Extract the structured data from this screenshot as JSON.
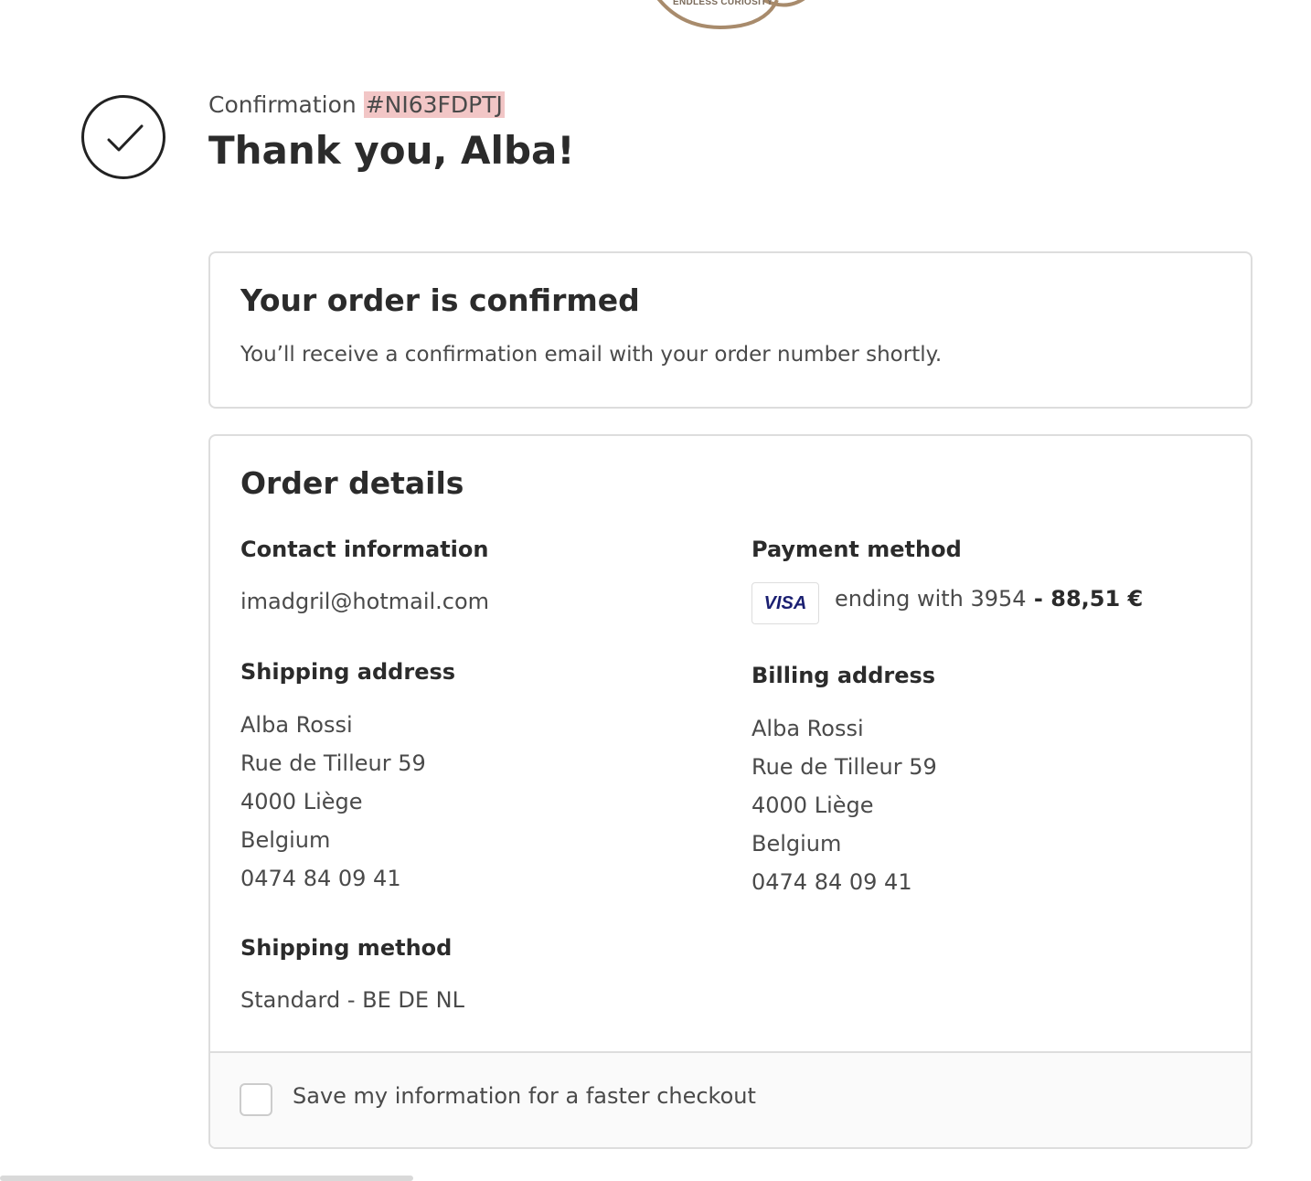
{
  "logo": {
    "tagline": "ENDLESS CURIOSITY",
    "color": "#a88b6c"
  },
  "header": {
    "confirmation_label": "Confirmation",
    "confirmation_number": "#NI63FDPTJ",
    "thank_you": "Thank you, Alba!",
    "icon": "check-circle-icon"
  },
  "confirmed_card": {
    "title": "Your order is confirmed",
    "text": "You’ll receive a confirmation email with your order number shortly."
  },
  "order_details": {
    "title": "Order details",
    "contact": {
      "label": "Contact information",
      "email": "imadgril@hotmail.com"
    },
    "payment": {
      "label": "Payment method",
      "card_brand": "VISA",
      "ending_text": "ending with 3954",
      "separator": " - ",
      "total": "88,51 €"
    },
    "shipping_address": {
      "label": "Shipping address",
      "lines": [
        "Alba Rossi",
        "Rue de Tilleur 59",
        "4000 Liège",
        "Belgium",
        "0474 84 09 41"
      ]
    },
    "billing_address": {
      "label": "Billing address",
      "lines": [
        "Alba Rossi",
        "Rue de Tilleur 59",
        "4000 Liège",
        "Belgium",
        "0474 84 09 41"
      ]
    },
    "shipping_method": {
      "label": "Shipping method",
      "value": "Standard - BE DE NL"
    },
    "save_info": {
      "label": "Save my information for a faster checkout",
      "checked": false
    }
  },
  "colors": {
    "highlight": "#f2c6c6",
    "border": "#dddddd",
    "text_dark": "#2b2b2b",
    "text_body": "#4a4a4a",
    "visa_blue": "#1a1f71"
  }
}
